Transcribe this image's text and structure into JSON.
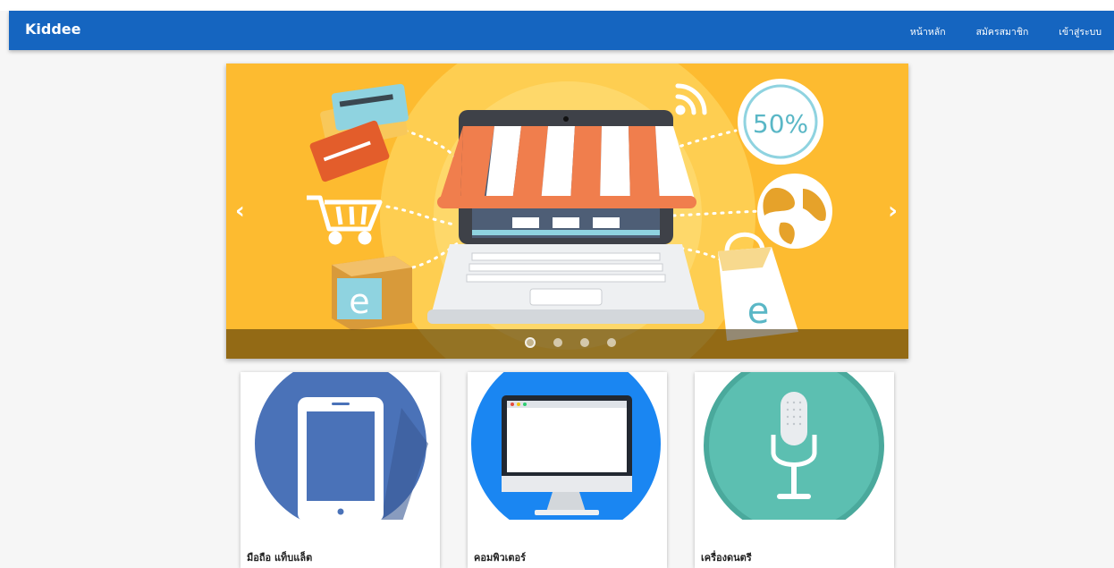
{
  "navbar": {
    "brand": "Kiddee",
    "links": [
      "หน้าหลัก",
      "สมัครสมาชิก",
      "เข้าสู่ระบบ"
    ],
    "color": "#1565c0"
  },
  "slider": {
    "discount_text": "50%",
    "prev_icon": "chevron-left-icon",
    "next_icon": "chevron-right-icon",
    "slide_count": 4,
    "active_slide": 1,
    "background": "#fdbb30"
  },
  "categories": [
    {
      "label": "มือถือ แท็บแล็ต",
      "icon": "tablet-icon",
      "color": "#4a72b8"
    },
    {
      "label": "คอมพิวเตอร์",
      "icon": "computer-monitor-icon",
      "color": "#1a86f2"
    },
    {
      "label": "เครื่องดนตรี",
      "icon": "microphone-icon",
      "color": "#5cbfb1"
    }
  ]
}
